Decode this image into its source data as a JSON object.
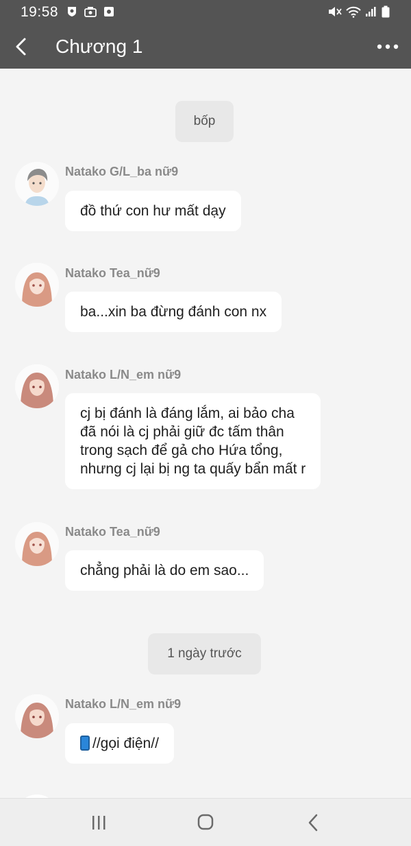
{
  "status_bar": {
    "time": "19:58",
    "left_icons": [
      "shield-notification-icon",
      "camera-notification-icon",
      "gallery-notification-icon"
    ],
    "right_icons": [
      "mute-vibrate-icon",
      "wifi-icon",
      "signal-icon",
      "battery-icon"
    ]
  },
  "app_bar": {
    "title": "Chương 1",
    "back_icon": "chevron-left-icon",
    "menu_icon": "more-horizontal-icon"
  },
  "chat": {
    "dividers": [
      "bốp",
      "1 ngày trước"
    ],
    "messages": [
      {
        "sender": "Natako G/L_ba nữ9",
        "text": "đồ thứ con hư mất dạy",
        "avatar": "father-avatar"
      },
      {
        "sender": "Natako Tea_nữ9",
        "text": "ba...xin ba đừng đánh con nx",
        "avatar": "tea-avatar"
      },
      {
        "sender": "Natako L/N_em nữ9",
        "text": "cj bị đánh là đáng lắm, ai bảo cha\nđã nói là cj phải giữ đc tấm thân\ntrong sạch để gả cho Hứa tổng,\nnhưng cj lại bị ng ta quấy bẩn mất r",
        "avatar": "sister-avatar"
      },
      {
        "sender": "Natako Tea_nữ9",
        "text": "chẳng phải là do em sao...",
        "avatar": "tea-avatar"
      },
      {
        "sender": "Natako L/N_em nữ9",
        "text": "//gọi điện//",
        "avatar": "sister-avatar",
        "icon": "mobile-phone-icon"
      }
    ]
  },
  "nav_bar": {
    "icons": [
      "recent-apps-icon",
      "home-icon",
      "back-icon"
    ]
  },
  "colors": {
    "bar_bg": "#545454",
    "chat_bg": "#f4f4f4",
    "chip_bg": "#e8e8e8",
    "bubble_bg": "#ffffff"
  }
}
